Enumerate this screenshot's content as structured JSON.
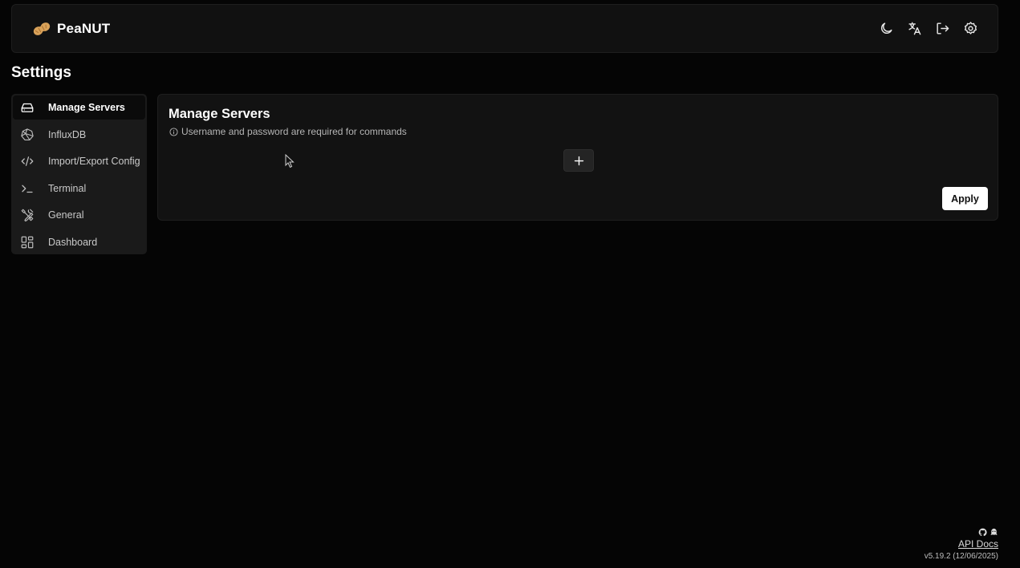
{
  "app": {
    "name": "PeaNUT",
    "logo_icon": "peanut-icon"
  },
  "header": {
    "actions": [
      {
        "icon": "moon-icon"
      },
      {
        "icon": "translate-icon"
      },
      {
        "icon": "logout-icon"
      },
      {
        "icon": "gear-icon"
      }
    ]
  },
  "page": {
    "title": "Settings"
  },
  "sidebar": {
    "items": [
      {
        "label": "Manage Servers",
        "icon": "server-icon",
        "active": true
      },
      {
        "label": "InfluxDB",
        "icon": "influxdb-icon",
        "active": false
      },
      {
        "label": "Import/Export Config",
        "icon": "code-icon",
        "active": false
      },
      {
        "label": "Terminal",
        "icon": "terminal-icon",
        "active": false
      },
      {
        "label": "General",
        "icon": "tools-icon",
        "active": false
      },
      {
        "label": "Dashboard",
        "icon": "dashboard-icon",
        "active": false
      }
    ]
  },
  "panel": {
    "title": "Manage Servers",
    "note": "Username and password are required for commands",
    "add_icon": "plus-icon",
    "apply_label": "Apply"
  },
  "footer": {
    "icons": [
      "github-icon",
      "ghost-icon"
    ],
    "api_docs": "API Docs",
    "version": "v5.19.2 (12/06/2025)"
  },
  "colors": {
    "background": "#050505",
    "surface": "#121212",
    "sidebar": "#1a1a1a",
    "accent": "#ffffff"
  }
}
